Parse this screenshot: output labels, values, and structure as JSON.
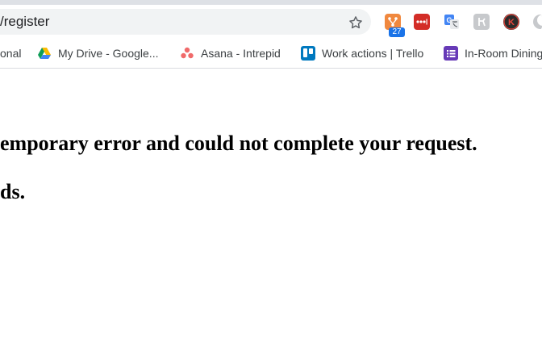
{
  "address_bar": {
    "url_text": "/register"
  },
  "toolbar": {
    "extensions": [
      {
        "name": "git-extension-icon",
        "badge": "27"
      },
      {
        "name": "lastpass-icon"
      },
      {
        "name": "translate-icon"
      },
      {
        "name": "extension-icon"
      },
      {
        "name": "profile-avatar-icon",
        "letter": "K"
      },
      {
        "name": "moon-extension-icon"
      }
    ]
  },
  "bookmarks": [
    {
      "label": "onal",
      "icon": "bookmark-icon"
    },
    {
      "label": "My Drive - Google...",
      "icon": "google-drive-icon"
    },
    {
      "label": "Asana - Intrepid",
      "icon": "asana-icon"
    },
    {
      "label": "Work actions | Trello",
      "icon": "trello-icon"
    },
    {
      "label": "In-Room Dining",
      "icon": "list-icon"
    }
  ],
  "page": {
    "line1": "emporary error and could not complete your request.",
    "line2": "ds."
  },
  "colors": {
    "accent": "#1a73e8",
    "toolbar_bg": "#f1f3f4",
    "tab_strip": "#dee1e6"
  }
}
